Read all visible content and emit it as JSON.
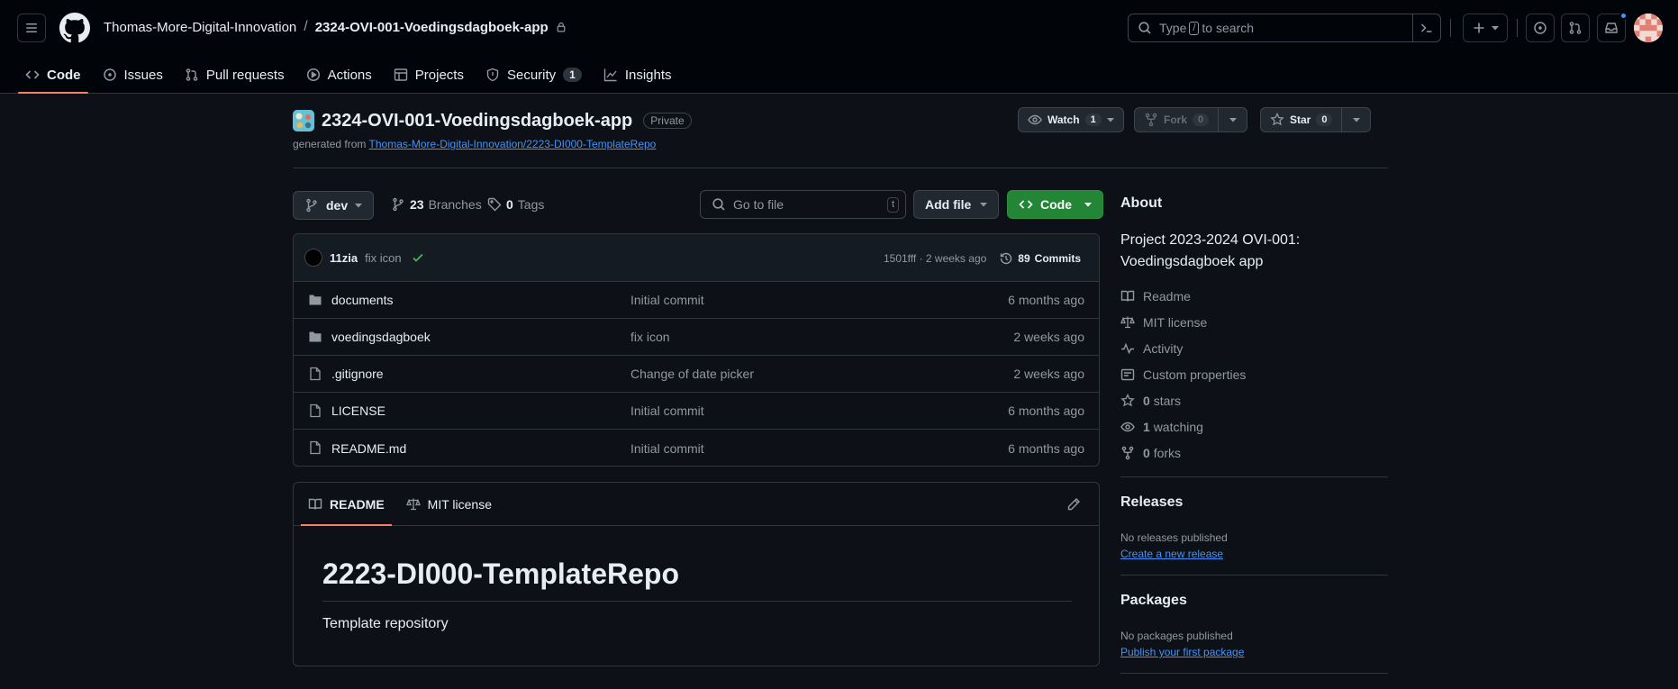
{
  "header": {
    "owner": "Thomas-More-Digital-Innovation",
    "separator": "/",
    "repo": "2324-OVI-001-Voedingsdagboek-app",
    "search_pre": "Type",
    "search_key": "/",
    "search_post": "to search"
  },
  "tabs": [
    {
      "label": "Code"
    },
    {
      "label": "Issues"
    },
    {
      "label": "Pull requests"
    },
    {
      "label": "Actions"
    },
    {
      "label": "Projects"
    },
    {
      "label": "Security",
      "count": "1"
    },
    {
      "label": "Insights"
    }
  ],
  "repo": {
    "name": "2324-OVI-001-Voedingsdagboek-app",
    "visibility": "Private",
    "generated_prefix": "generated from",
    "generated_link": "Thomas-More-Digital-Innovation/2223-DI000-TemplateRepo",
    "watch_label": "Watch",
    "watch_count": "1",
    "fork_label": "Fork",
    "fork_count": "0",
    "star_label": "Star",
    "star_count": "0"
  },
  "toolbar": {
    "branch": "dev",
    "branches_count": "23",
    "branches_label": "Branches",
    "tags_count": "0",
    "tags_label": "Tags",
    "goto_placeholder": "Go to file",
    "goto_key": "t",
    "add_file": "Add file",
    "code": "Code"
  },
  "commit": {
    "author": "11zia",
    "message": "fix icon",
    "hash_age": "1501fff · 2 weeks ago",
    "commits_count": "89",
    "commits_label": "Commits"
  },
  "files": [
    {
      "type": "folder",
      "name": "documents",
      "message": "Initial commit",
      "age": "6 months ago"
    },
    {
      "type": "folder",
      "name": "voedingsdagboek",
      "message": "fix icon",
      "age": "2 weeks ago"
    },
    {
      "type": "file",
      "name": ".gitignore",
      "message": "Change of date picker",
      "age": "2 weeks ago"
    },
    {
      "type": "file",
      "name": "LICENSE",
      "message": "Initial commit",
      "age": "6 months ago"
    },
    {
      "type": "file",
      "name": "README.md",
      "message": "Initial commit",
      "age": "6 months ago"
    }
  ],
  "readme": {
    "tab_readme": "README",
    "tab_license": "MIT license",
    "heading": "2223-DI000-TemplateRepo",
    "body": "Template repository"
  },
  "about": {
    "title": "About",
    "description": "Project 2023-2024 OVI-001: Voedingsdagboek app",
    "readme": "Readme",
    "license": "MIT license",
    "activity": "Activity",
    "custom_properties": "Custom properties",
    "stars_count": "0",
    "stars_label": "stars",
    "watching_count": "1",
    "watching_label": "watching",
    "forks_count": "0",
    "forks_label": "forks"
  },
  "releases": {
    "title": "Releases",
    "empty": "No releases published",
    "link": "Create a new release"
  },
  "packages": {
    "title": "Packages",
    "empty": "No packages published",
    "link": "Publish your first package"
  },
  "colors": {
    "background": "#0d1117",
    "header_bg": "#010409",
    "accent_tab": "#f78166",
    "primary_button": "#238636",
    "link": "#4493f8"
  }
}
